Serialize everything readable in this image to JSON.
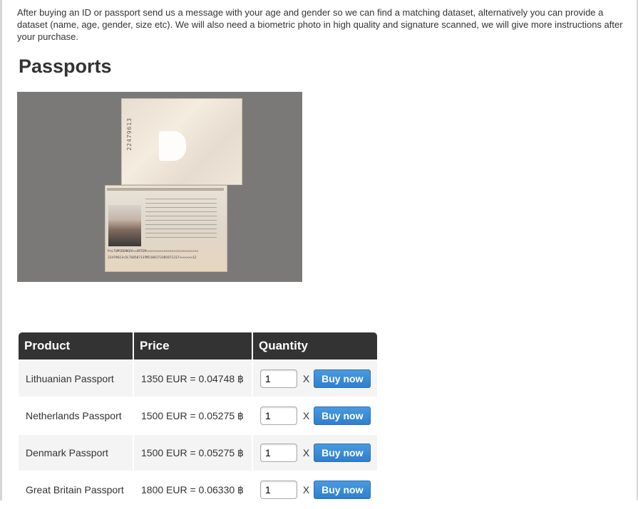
{
  "intro": {
    "text": "After buying an ID or passport send us a message with your age and gender so we can find a matching dataset, alternatively you can provide a dataset (name, age, gender, size etc). We will also need a biometric photo in high quality and signature scanned, we will give more instructions after your purchase."
  },
  "section": {
    "title": "Passports"
  },
  "photo": {
    "vertical_number": "22479613",
    "mrz_line1": "P<LTUMSRENKOV<<ARTEM<<<<<<<<<<<<<<<<<<<<<<<<<<<",
    "mrz_line2": "22479613<5LTU8507135M2108173385071317<<<<<<<12"
  },
  "table": {
    "headers": {
      "product": "Product",
      "price": "Price",
      "quantity": "Quantity"
    },
    "times_symbol": "X",
    "buy_label": "Buy now",
    "rows": [
      {
        "product": "Lithuanian Passport",
        "price": "1350 EUR = 0.04748 ฿",
        "quantity": "1"
      },
      {
        "product": "Netherlands Passport",
        "price": "1500 EUR = 0.05275 ฿",
        "quantity": "1"
      },
      {
        "product": "Denmark Passport",
        "price": "1500 EUR = 0.05275 ฿",
        "quantity": "1"
      },
      {
        "product": "Great Britain Passport",
        "price": "1800 EUR = 0.06330 ฿",
        "quantity": "1"
      }
    ]
  },
  "colors": {
    "table_header_bg": "#333333",
    "button_blue": "#2f7fcd",
    "row_alt_bg": "#f4f4f4"
  }
}
